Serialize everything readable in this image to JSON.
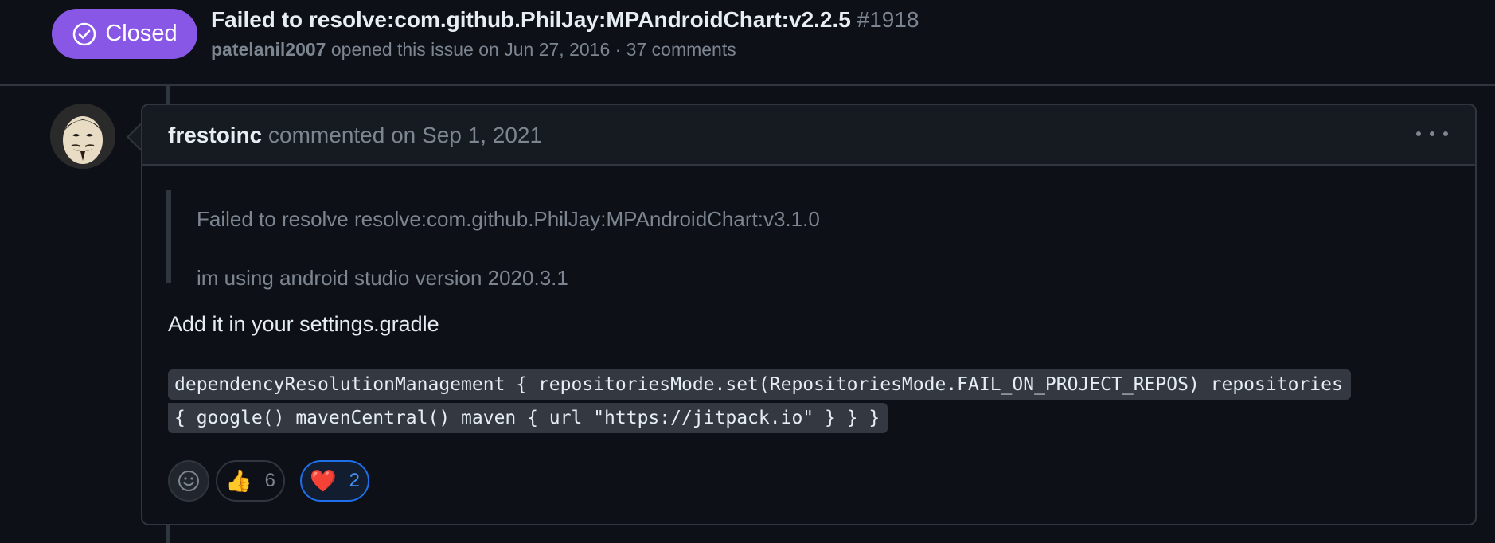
{
  "issue": {
    "state": "Closed",
    "title": "Failed to resolve:com.github.PhilJay:MPAndroidChart:v2.2.5",
    "number": "#1918",
    "author": "patelanil2007",
    "meta": "opened this issue on Jun 27, 2016 · 37 comments"
  },
  "comment": {
    "author": "frestoinc",
    "date": "commented on Sep 1, 2021",
    "quote_lines": [
      "Failed to resolve resolve:com.github.PhilJay:MPAndroidChart:v3.1.0",
      "im using android studio version 2020.3.1"
    ],
    "body": "Add it in your settings.gradle",
    "code_lines": [
      "dependencyResolutionManagement { repositoriesMode.set(RepositoriesMode.FAIL_ON_PROJECT_REPOS) repositories",
      "{ google() mavenCentral() maven { url \"https://jitpack.io\" } } }"
    ],
    "reactions": [
      {
        "emoji": "👍",
        "count": "6",
        "name": "thumbs-up"
      },
      {
        "emoji": "❤️",
        "count": "2",
        "name": "heart"
      }
    ]
  },
  "icons": {
    "state": "check-circle-icon",
    "add_reaction": "smiley-icon",
    "menu": "kebab-horizontal-icon"
  },
  "colors": {
    "background": "#0d1117",
    "closed_badge": "#8957e5",
    "border": "#30363d",
    "muted": "#7d8590",
    "accent": "#1f6feb"
  }
}
